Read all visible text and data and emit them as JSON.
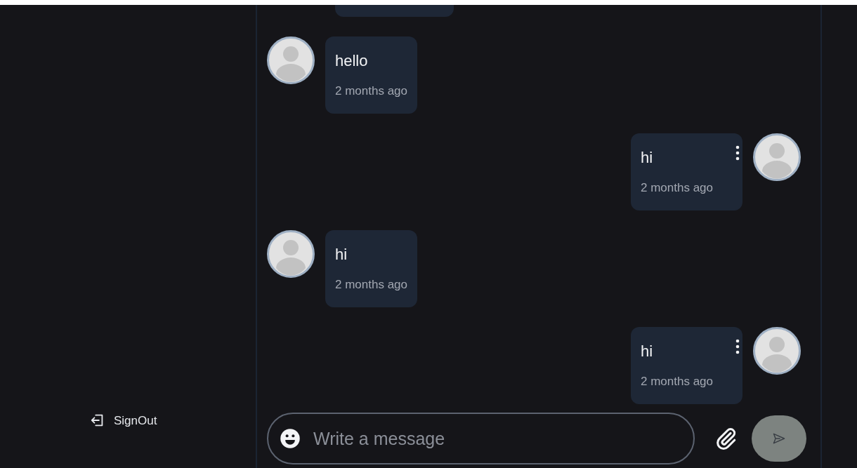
{
  "sidebar": {
    "sign_out": "SignOut"
  },
  "messages": [
    {
      "kind": "incoming",
      "text": "hello",
      "time": "2 months ago"
    },
    {
      "kind": "outgoing",
      "text": "hi",
      "time": "2 months ago"
    },
    {
      "kind": "incoming",
      "text": "hi",
      "time": "2 months ago"
    },
    {
      "kind": "outgoing",
      "text": "hi",
      "time": "2 months ago"
    }
  ],
  "composer": {
    "placeholder": "Write a message"
  }
}
